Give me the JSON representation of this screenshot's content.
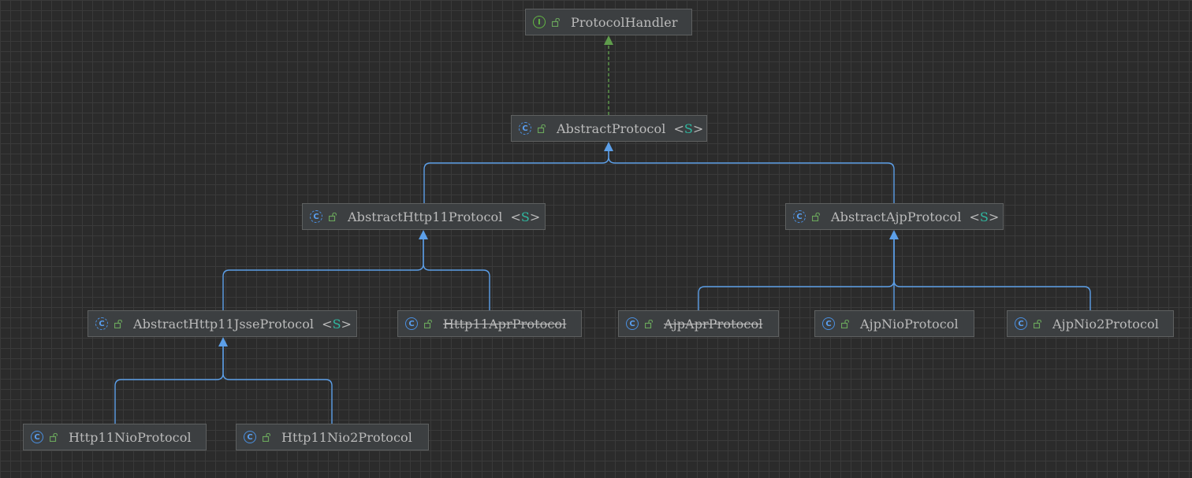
{
  "diagram": {
    "nodes": [
      {
        "id": "protocol-handler",
        "name": "ProtocolHandler",
        "kind": "interface",
        "icon_letter": "I",
        "deprecated": false,
        "type_param": ""
      },
      {
        "id": "abstract-protocol",
        "name": "AbstractProtocol",
        "kind": "abstract-class",
        "icon_letter": "C",
        "deprecated": false,
        "type_param": "S"
      },
      {
        "id": "abstract-http11-protocol",
        "name": "AbstractHttp11Protocol",
        "kind": "abstract-class",
        "icon_letter": "C",
        "deprecated": false,
        "type_param": "S"
      },
      {
        "id": "abstract-ajp-protocol",
        "name": "AbstractAjpProtocol",
        "kind": "abstract-class",
        "icon_letter": "C",
        "deprecated": false,
        "type_param": "S"
      },
      {
        "id": "abstract-http11-jsse-protocol",
        "name": "AbstractHttp11JsseProtocol",
        "kind": "abstract-class",
        "icon_letter": "C",
        "deprecated": false,
        "type_param": "S"
      },
      {
        "id": "http11-apr-protocol",
        "name": "Http11AprProtocol",
        "kind": "class",
        "icon_letter": "C",
        "deprecated": true,
        "type_param": ""
      },
      {
        "id": "ajp-apr-protocol",
        "name": "AjpAprProtocol",
        "kind": "class",
        "icon_letter": "C",
        "deprecated": true,
        "type_param": ""
      },
      {
        "id": "ajp-nio-protocol",
        "name": "AjpNioProtocol",
        "kind": "class",
        "icon_letter": "C",
        "deprecated": false,
        "type_param": ""
      },
      {
        "id": "ajp-nio2-protocol",
        "name": "AjpNio2Protocol",
        "kind": "class",
        "icon_letter": "C",
        "deprecated": false,
        "type_param": ""
      },
      {
        "id": "http11-nio-protocol",
        "name": "Http11NioProtocol",
        "kind": "class",
        "icon_letter": "C",
        "deprecated": false,
        "type_param": ""
      },
      {
        "id": "http11-nio2-protocol",
        "name": "Http11Nio2Protocol",
        "kind": "class",
        "icon_letter": "C",
        "deprecated": false,
        "type_param": ""
      }
    ],
    "edges": [
      {
        "from": "abstract-protocol",
        "to": "protocol-handler",
        "type": "implements"
      },
      {
        "from": "abstract-http11-protocol",
        "to": "abstract-protocol",
        "type": "extends"
      },
      {
        "from": "abstract-ajp-protocol",
        "to": "abstract-protocol",
        "type": "extends"
      },
      {
        "from": "abstract-http11-jsse-protocol",
        "to": "abstract-http11-protocol",
        "type": "extends"
      },
      {
        "from": "http11-apr-protocol",
        "to": "abstract-http11-protocol",
        "type": "extends"
      },
      {
        "from": "ajp-apr-protocol",
        "to": "abstract-ajp-protocol",
        "type": "extends"
      },
      {
        "from": "ajp-nio-protocol",
        "to": "abstract-ajp-protocol",
        "type": "extends"
      },
      {
        "from": "ajp-nio2-protocol",
        "to": "abstract-ajp-protocol",
        "type": "extends"
      },
      {
        "from": "http11-nio-protocol",
        "to": "abstract-http11-jsse-protocol",
        "type": "extends"
      },
      {
        "from": "http11-nio2-protocol",
        "to": "abstract-http11-jsse-protocol",
        "type": "extends"
      }
    ],
    "colors": {
      "background": "#2b2b2b",
      "grid": "#3a3a3a",
      "node_fill": "#3c3f41",
      "node_border": "#5e6060",
      "text": "#bbbbbb",
      "extends_edge": "#5c9fe8",
      "implements_edge": "#5f9c4c",
      "interface_icon": "#62b543",
      "class_icon": "#4a8fe0",
      "type_param": "#2fb8a0",
      "lock_icon": "#6aa55b"
    }
  }
}
